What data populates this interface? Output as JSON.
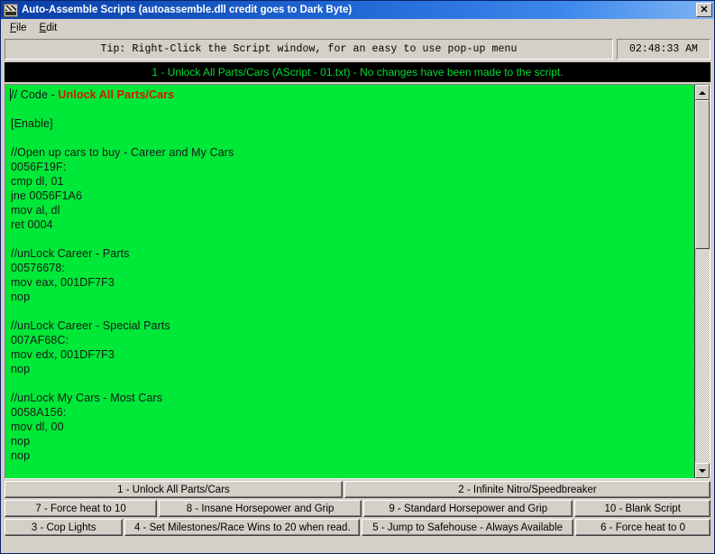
{
  "window": {
    "title": "Auto-Assemble Scripts (autoassemble.dll credit goes to Dark Byte)",
    "icon": "app-icon",
    "close_label": "✕"
  },
  "menubar": {
    "items": [
      {
        "label": "File",
        "accel": "F"
      },
      {
        "label": "Edit",
        "accel": "E"
      }
    ]
  },
  "tipbar": {
    "tip": "Tip: Right-Click the Script window, for an easy to use pop-up menu",
    "clock": "02:48:33 AM"
  },
  "statusbar": {
    "text": "1 - Unlock All Parts/Cars (AScript - 01.txt)  - No changes have been made to the script.",
    "text_color": "#00dd33",
    "background_color": "#000000"
  },
  "editor": {
    "background_color": "#00e838",
    "highlight_color": "#d01a00",
    "lines": [
      {
        "text": "// Code - ",
        "highlight": "Unlock All Parts/Cars"
      },
      {
        "text": ""
      },
      {
        "text": "[Enable]"
      },
      {
        "text": ""
      },
      {
        "text": "//Open up cars to buy - Career and My Cars"
      },
      {
        "text": "0056F19F:"
      },
      {
        "text": "cmp dl, 01"
      },
      {
        "text": "jne 0056F1A6"
      },
      {
        "text": "mov al, dl"
      },
      {
        "text": "ret 0004"
      },
      {
        "text": ""
      },
      {
        "text": "//unLock Career - Parts"
      },
      {
        "text": "00576678:"
      },
      {
        "text": "mov eax, 001DF7F3"
      },
      {
        "text": "nop"
      },
      {
        "text": ""
      },
      {
        "text": "//unLock Career - Special Parts"
      },
      {
        "text": "007AF68C:"
      },
      {
        "text": "mov edx, 001DF7F3"
      },
      {
        "text": "nop"
      },
      {
        "text": ""
      },
      {
        "text": "//unLock My Cars - Most Cars"
      },
      {
        "text": "0058A156:"
      },
      {
        "text": "mov dl, 00"
      },
      {
        "text": "nop"
      },
      {
        "text": "nop"
      }
    ]
  },
  "scrollbar": {
    "up_arrow": "scroll-up-icon",
    "down_arrow": "scroll-down-icon"
  },
  "script_buttons": {
    "row1": [
      {
        "label": "1 - Unlock All Parts/Cars",
        "flex": 48
      },
      {
        "label": "2 - Infinite Nitro/Speedbreaker",
        "flex": 52
      }
    ],
    "row2": [
      {
        "label": "7 - Force heat to 10",
        "flex": 22.5
      },
      {
        "label": "8 - Insane Horsepower and Grip",
        "flex": 30
      },
      {
        "label": "9 - Standard Horsepower and Grip",
        "flex": 31
      },
      {
        "label": "10 - Blank Script",
        "flex": 20
      }
    ],
    "row3": [
      {
        "label": "3 - Cop Lights",
        "flex": 17.5
      },
      {
        "label": "4 - Set Milestones/Race Wins to 20 when read.",
        "flex": 35
      },
      {
        "label": "5 - Jump to Safehouse - Always Available",
        "flex": 31.5
      },
      {
        "label": "6 - Force heat to 0",
        "flex": 20
      }
    ]
  }
}
